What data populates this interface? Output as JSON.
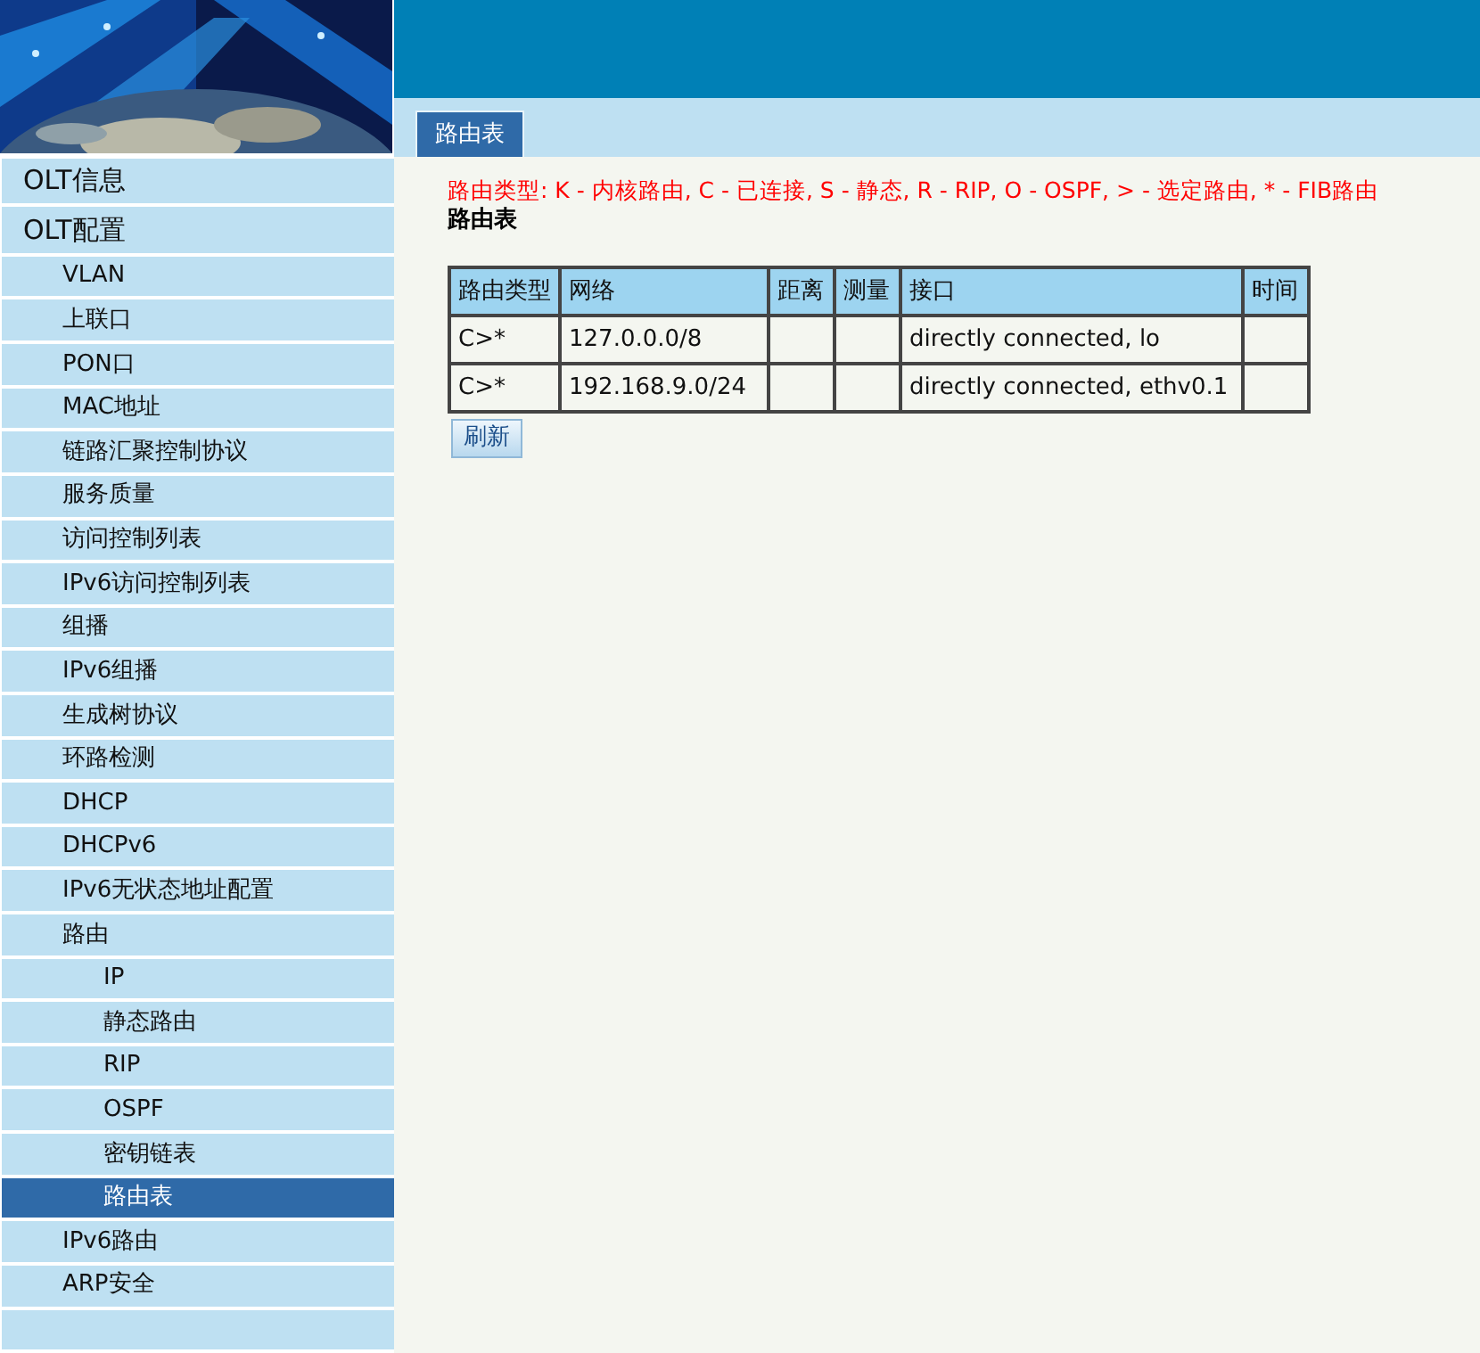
{
  "header": {
    "banner": {
      "kind": "picture"
    }
  },
  "sidebar": {
    "items": [
      {
        "label": "OLT信息",
        "selected": false
      },
      {
        "label": "OLT配置",
        "selected": false,
        "children": [
          {
            "label": "VLAN",
            "selected": false
          },
          {
            "label": "上联口",
            "selected": false
          },
          {
            "label": "PON口",
            "selected": false
          },
          {
            "label": "MAC地址",
            "selected": false
          },
          {
            "label": "链路汇聚控制协议",
            "selected": false
          },
          {
            "label": "服务质量",
            "selected": false
          },
          {
            "label": "访问控制列表",
            "selected": false
          },
          {
            "label": "IPv6访问控制列表",
            "selected": false
          },
          {
            "label": "组播",
            "selected": false
          },
          {
            "label": "IPv6组播",
            "selected": false
          },
          {
            "label": "生成树协议",
            "selected": false
          },
          {
            "label": "环路检测",
            "selected": false
          },
          {
            "label": "DHCP",
            "selected": false
          },
          {
            "label": "DHCPv6",
            "selected": false
          },
          {
            "label": "IPv6无状态地址配置",
            "selected": false
          },
          {
            "label": "路由",
            "selected": false,
            "children": [
              {
                "label": "IP",
                "selected": false
              },
              {
                "label": "静态路由",
                "selected": false
              },
              {
                "label": "RIP",
                "selected": false
              },
              {
                "label": "OSPF",
                "selected": false
              },
              {
                "label": "密钥链表",
                "selected": false
              },
              {
                "label": "路由表",
                "selected": true
              }
            ]
          },
          {
            "label": "IPv6路由",
            "selected": false
          },
          {
            "label": "ARP安全",
            "selected": false
          },
          {
            "selected": false
          }
        ]
      }
    ]
  },
  "tabs": [
    {
      "label": "路由表",
      "selected": true
    }
  ],
  "legend": "路由类型: K - 内核路由, C - 已连接, S - 静态, R - RIP, O - OSPF, > - 选定路由, * - FIB路由",
  "section_title": "路由表",
  "table": {
    "columns": [
      "路由类型",
      "网络",
      "距离",
      "测量",
      "接口",
      "时间"
    ],
    "rows": [
      [
        "C>*",
        "127.0.0.0/8",
        "",
        "",
        "directly connected, lo",
        ""
      ],
      [
        "C>*",
        "192.168.9.0/24",
        "",
        "",
        "directly connected, ethv0.1",
        ""
      ]
    ]
  },
  "buttons": [
    "刷新"
  ]
}
